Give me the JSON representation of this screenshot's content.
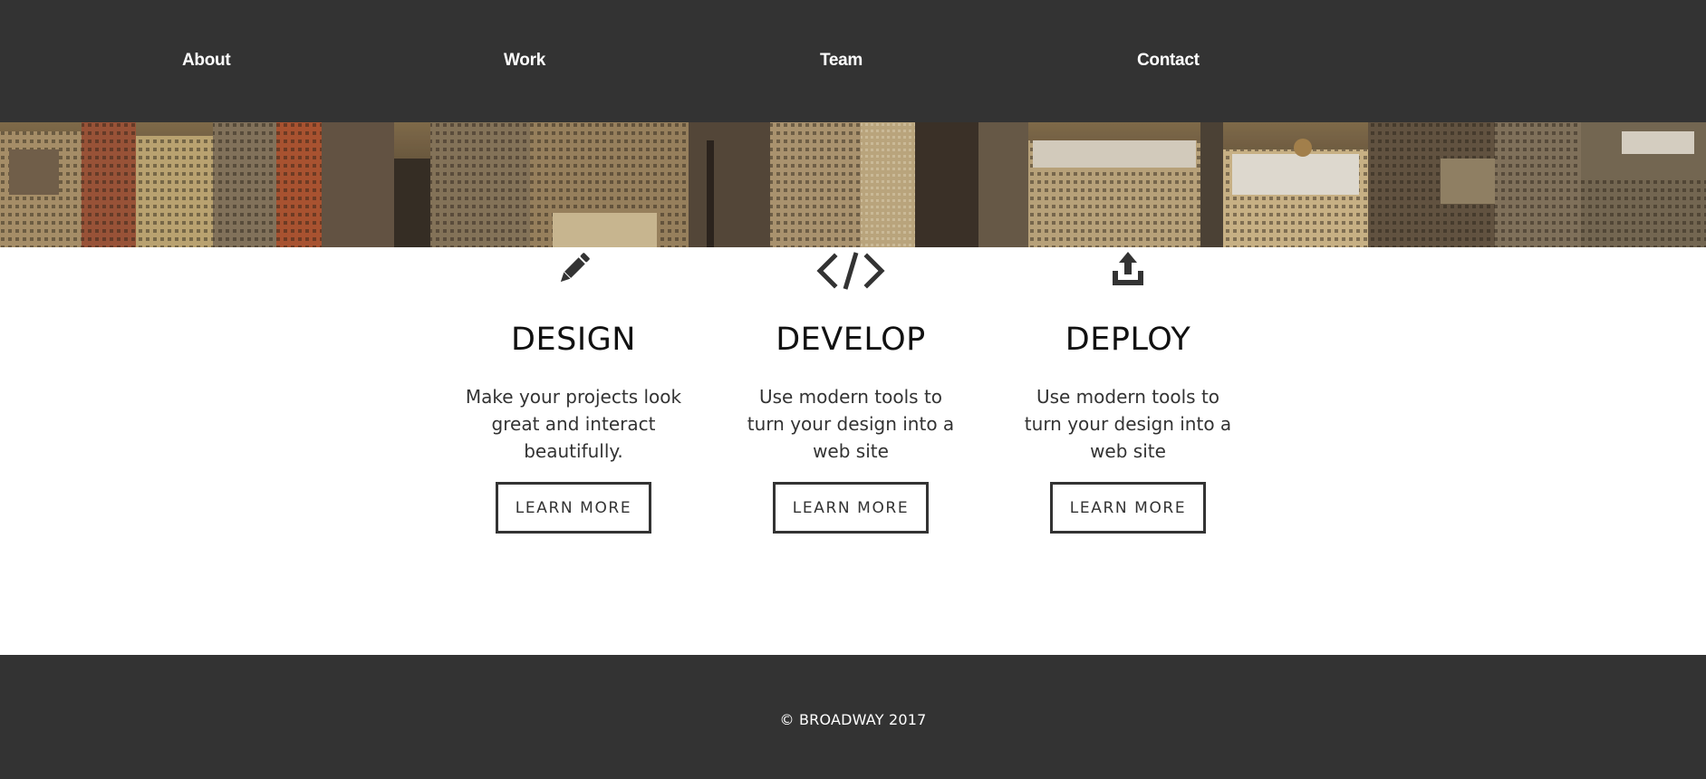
{
  "nav": {
    "items": [
      {
        "label": "About"
      },
      {
        "label": "Work"
      },
      {
        "label": "Team"
      },
      {
        "label": "Contact"
      }
    ]
  },
  "hero": {
    "icon": "city-skyline-image"
  },
  "services": [
    {
      "icon": "pencil-icon",
      "title": "DESIGN",
      "description": "Make your projects look great and interact beautifully.",
      "button": "LEARN MORE"
    },
    {
      "icon": "code-icon",
      "title": "DEVELOP",
      "description": "Use modern tools to turn your design into a web site",
      "button": "LEARN MORE"
    },
    {
      "icon": "upload-icon",
      "title": "DEPLOY",
      "description": "Use modern tools to turn your design into a web site",
      "button": "LEARN MORE"
    }
  ],
  "footer": {
    "copyright": "© BROADWAY 2017"
  },
  "colors": {
    "dark": "#333333",
    "text": "#111111",
    "white": "#ffffff"
  }
}
